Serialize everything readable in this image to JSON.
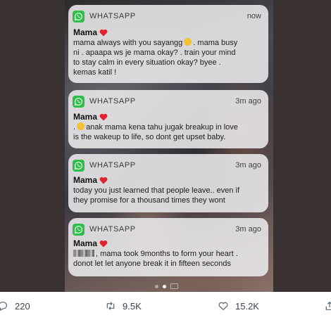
{
  "notifications": [
    {
      "app": "WHATSAPP",
      "time": "now",
      "sender": "Mama",
      "lines": [
        "mama always with you sayangg",
        ". mama busy",
        "ni . apaapa ws je mama okay? . train your mind",
        "to stay calm in every situation okay? byee .",
        "kemas katil !"
      ]
    },
    {
      "app": "WHATSAPP",
      "time": "3m ago",
      "sender": "Mama",
      "lines": [
        ".",
        "anak mama kena tahu jugak breakup in love",
        "is the wakeup to life, so dont get upset baby."
      ]
    },
    {
      "app": "WHATSAPP",
      "time": "3m ago",
      "sender": "Mama",
      "lines": [
        "today you just learned that people leave.. even if",
        "they promise for a thousand times they wont"
      ]
    },
    {
      "app": "WHATSAPP",
      "time": "3m ago",
      "sender": "Mama",
      "lines": [
        ", mama took 9months to form your heart .",
        "donot let let anyone break it in fifteen seconds"
      ]
    }
  ],
  "tweet_actions": {
    "reply_count": "220",
    "retweet_count": "9.5K",
    "like_count": "15.2K"
  },
  "colors": {
    "whatsapp_green": "#2fbd4b",
    "heart_red": "#e0242f",
    "action_gray": "#536471"
  },
  "icons": [
    "whatsapp-icon",
    "heart-emoji-icon",
    "reply-icon",
    "retweet-icon",
    "like-icon",
    "share-icon",
    "camera-icon"
  ]
}
